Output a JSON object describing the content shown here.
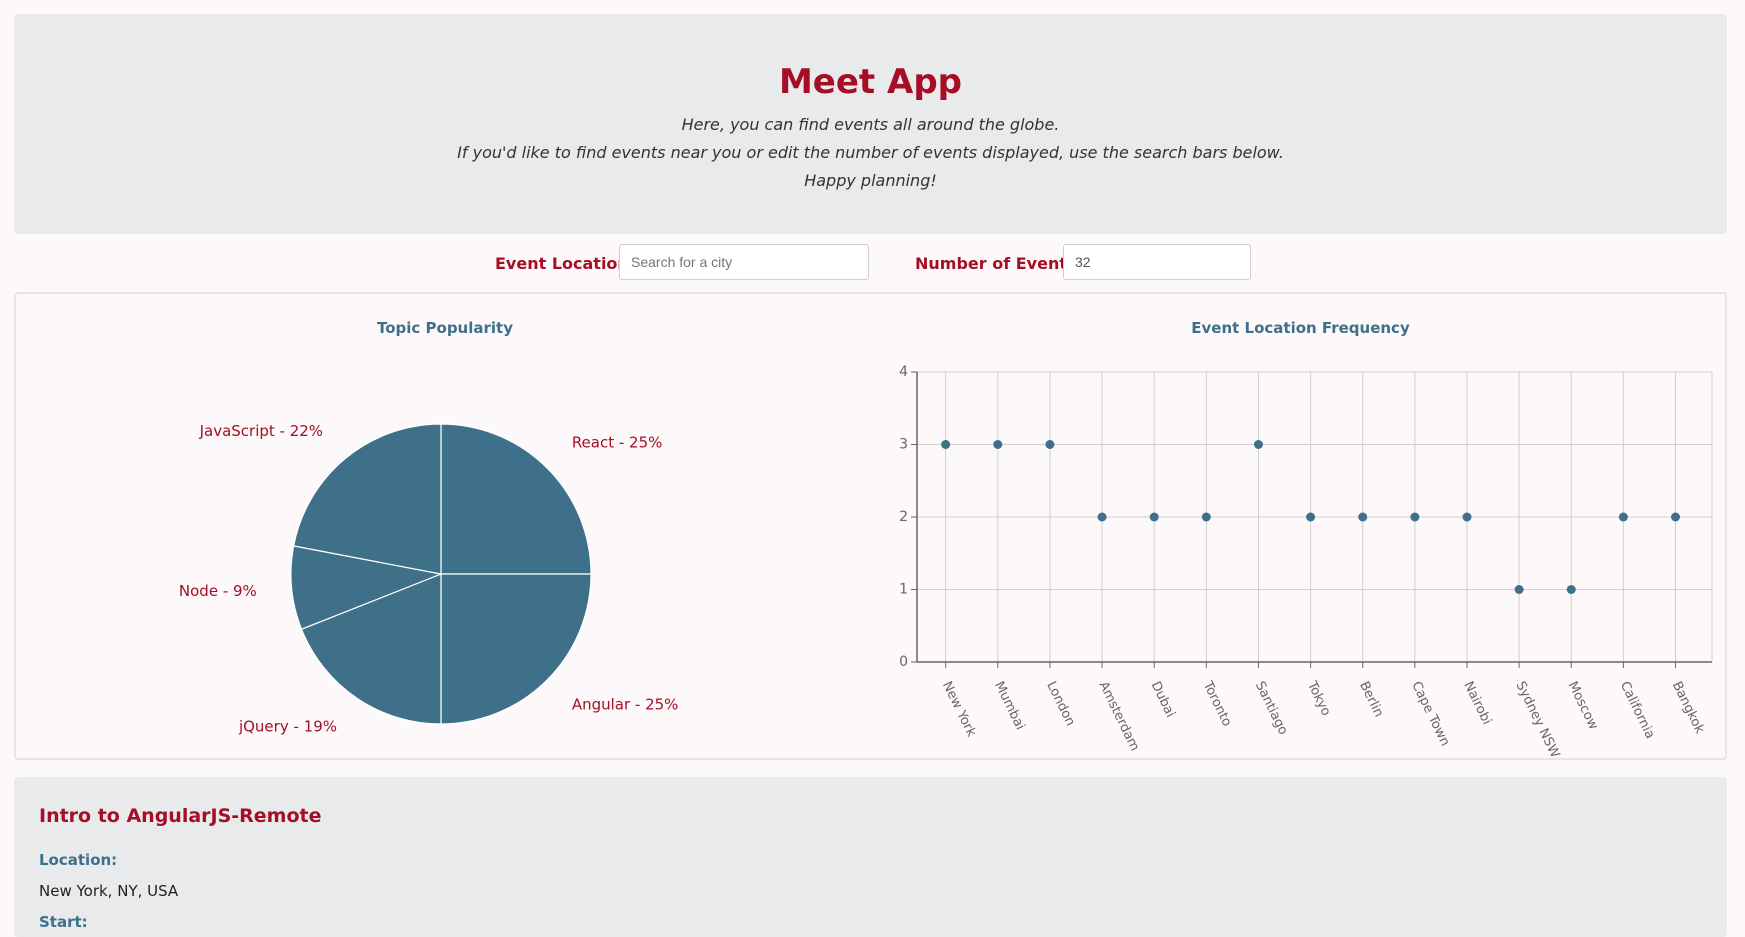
{
  "header": {
    "title": "Meet App",
    "lines": [
      "Here, you can find events all around the globe.",
      "If you'd like to find events near you or edit the number of events displayed, use the search bars below.",
      "Happy planning!"
    ]
  },
  "search": {
    "location_label": "Event Location:",
    "location_placeholder": "Search for a city",
    "location_value": "",
    "count_label": "Number of Events:",
    "count_value": "32"
  },
  "colors": {
    "accent": "#a50e24",
    "chart": "#3e7089",
    "panel": "#e8eaec",
    "background": "#fdf8f9"
  },
  "chart_data": [
    {
      "type": "pie",
      "title": "Topic Popularity",
      "slices": [
        {
          "label": "React",
          "value": 25,
          "text": "React - 25%"
        },
        {
          "label": "Angular",
          "value": 25,
          "text": "Angular - 25%"
        },
        {
          "label": "jQuery",
          "value": 19,
          "text": "jQuery - 19%"
        },
        {
          "label": "Node",
          "value": 9,
          "text": "Node - 9%"
        },
        {
          "label": "JavaScript",
          "value": 22,
          "text": "JavaScript - 22%"
        }
      ]
    },
    {
      "type": "scatter",
      "title": "Event Location Frequency",
      "categories": [
        "New York",
        "Mumbai",
        "London",
        "Amsterdam",
        "Dubai",
        "Toronto",
        "Santiago",
        "Tokyo",
        "Berlin",
        "Cape Town",
        "Nairobi",
        "Sydney NSW",
        "Moscow",
        "California",
        "Bangkok"
      ],
      "values": [
        3,
        3,
        3,
        2,
        2,
        2,
        3,
        2,
        2,
        2,
        2,
        1,
        1,
        2,
        2
      ],
      "ylim": [
        0,
        4
      ],
      "yticks": [
        0,
        1,
        2,
        3,
        4
      ],
      "grid": true
    }
  ],
  "event": {
    "title": "Intro to AngularJS-Remote",
    "location_label": "Location:",
    "location_value": "New York, NY, USA",
    "start_label": "Start:"
  }
}
